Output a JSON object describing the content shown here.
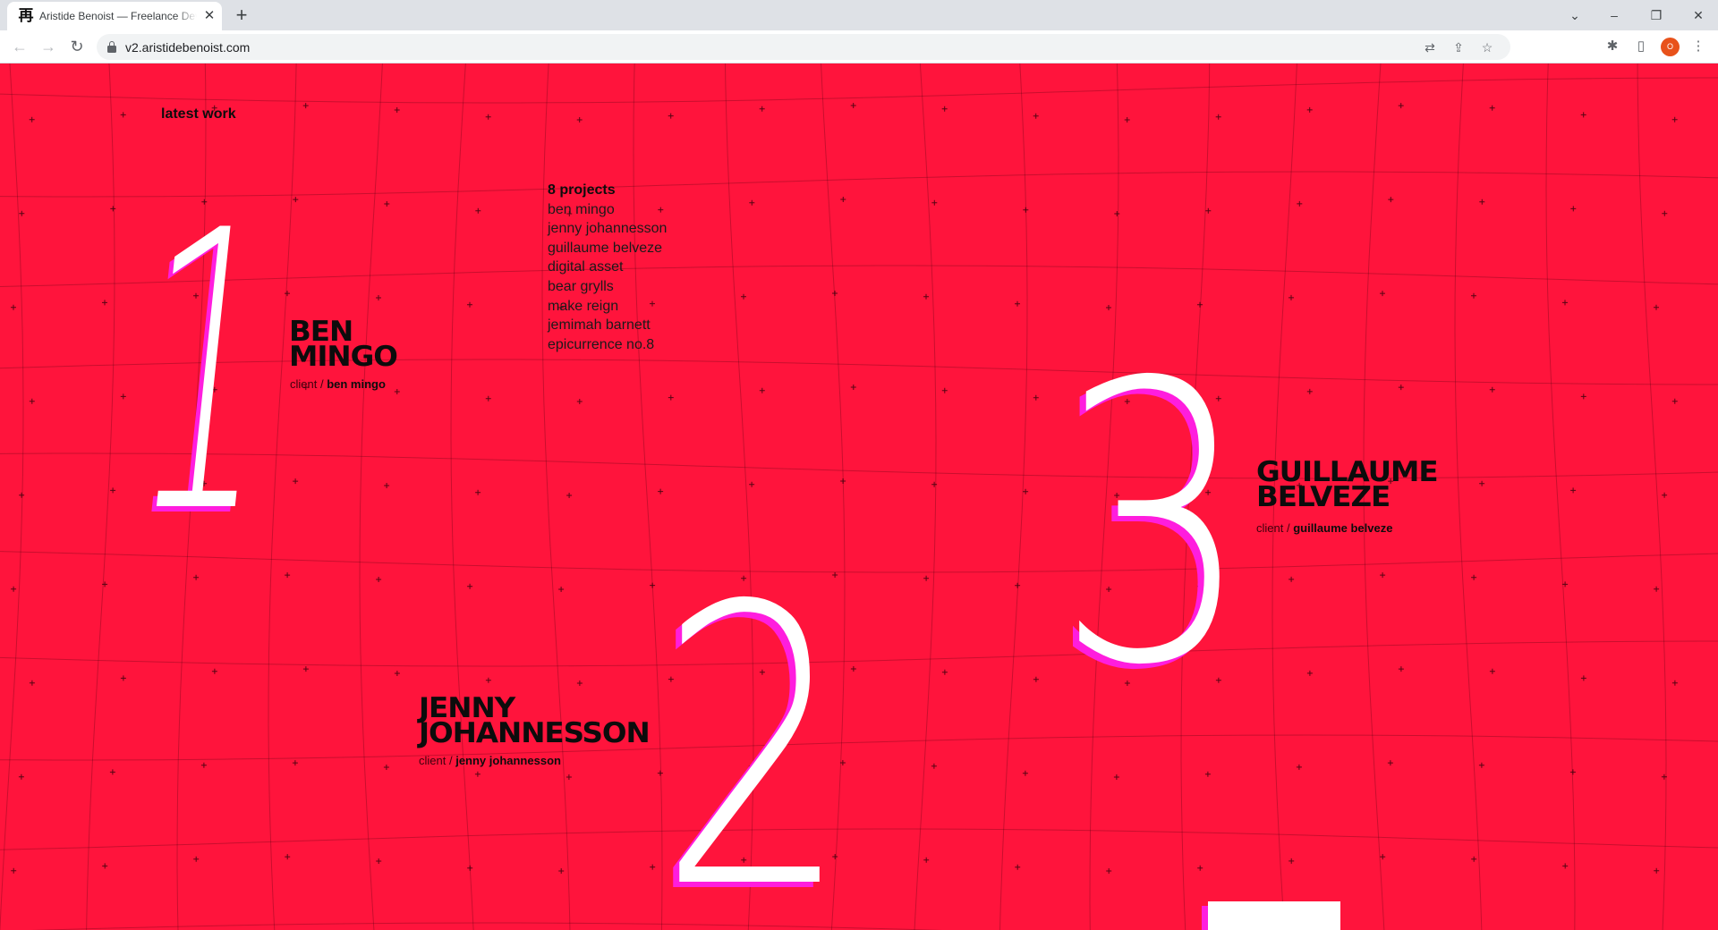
{
  "browser": {
    "tab_title": "Aristide Benoist — Freelance Developer",
    "tab_favicon": "再",
    "close_glyph": "✕",
    "new_tab_glyph": "+",
    "url": "v2.aristidebenoist.com",
    "profile_initial": "O",
    "icons": [
      "back-icon",
      "forward-icon",
      "reload-icon",
      "lock-icon",
      "translate-icon",
      "share-icon",
      "star-icon",
      "extensions-icon",
      "side-panel-icon",
      "menu-icon"
    ]
  },
  "page": {
    "accent": "#ff143c",
    "shadow": "#ff1dde",
    "latest_label": "latest work",
    "projects_count": "8 projects",
    "projects": [
      "ben mingo",
      "jenny johannesson",
      "guillaume belveze",
      "digital asset",
      "bear grylls",
      "make reign",
      "jemimah barnett",
      "epicurrence no.8"
    ],
    "works": [
      {
        "number": "1",
        "title_line1": "BEN",
        "title_line2": "MINGO",
        "client_label": "client /",
        "client": "ben mingo"
      },
      {
        "number": "2",
        "title_line1": "JENNY",
        "title_line2": "JOHANNESSON",
        "client_label": "client /",
        "client": "jenny johannesson"
      },
      {
        "number": "3",
        "title_line1": "GUILLAUME",
        "title_line2": "BELVEZE",
        "client_label": "client /",
        "client": "guillaume belveze"
      }
    ]
  }
}
